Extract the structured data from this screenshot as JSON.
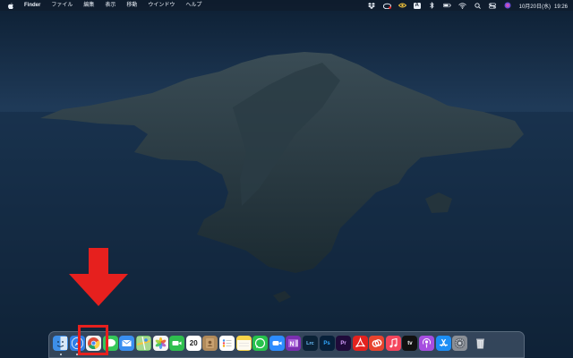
{
  "menubar": {
    "app_name": "Finder",
    "menus": [
      "ファイル",
      "編集",
      "表示",
      "移動",
      "ウインドウ",
      "ヘルプ"
    ],
    "status_icons": [
      "dropbox-icon",
      "creative-cloud-icon",
      "eye-icon",
      "text-input-icon",
      "bluetooth-icon",
      "battery-icon",
      "wifi-icon",
      "search-icon",
      "control-center-icon",
      "siri-icon"
    ],
    "input_source": "A",
    "date": "10月20日(水)",
    "time": "19:26"
  },
  "dock": {
    "apps": [
      {
        "name": "Finder",
        "icon": "finder-icon",
        "color": "#3d8fe8",
        "glyph": "",
        "running": true
      },
      {
        "name": "Safari",
        "icon": "safari-icon",
        "color": "#2f7ee6",
        "glyph": "",
        "running": true
      },
      {
        "name": "Chrome",
        "icon": "chrome-icon",
        "color": "#f1f1f1",
        "glyph": "",
        "running": false
      },
      {
        "name": "Messages",
        "icon": "messages-icon",
        "color": "#35c759",
        "glyph": "",
        "running": false
      },
      {
        "name": "Mail",
        "icon": "mail-icon",
        "color": "#3a8ff0",
        "glyph": "",
        "running": false
      },
      {
        "name": "Maps",
        "icon": "maps-icon",
        "color": "#6fc46a",
        "glyph": "",
        "running": false
      },
      {
        "name": "Photos",
        "icon": "photos-icon",
        "color": "#f5f5f5",
        "glyph": "",
        "running": false
      },
      {
        "name": "FaceTime",
        "icon": "facetime-icon",
        "color": "#2fbf4f",
        "glyph": "",
        "running": false
      },
      {
        "name": "Calendar",
        "icon": "calendar-icon",
        "color": "#ffffff",
        "glyph": "20",
        "running": false
      },
      {
        "name": "Contacts",
        "icon": "contacts-icon",
        "color": "#b08a5b",
        "glyph": "",
        "running": false
      },
      {
        "name": "Reminders",
        "icon": "reminders-icon",
        "color": "#ffffff",
        "glyph": "",
        "running": false
      },
      {
        "name": "Notes",
        "icon": "notes-icon",
        "color": "#f8d44a",
        "glyph": "",
        "running": false
      },
      {
        "name": "WhatsApp",
        "icon": "whatsapp-icon",
        "color": "#27c24c",
        "glyph": "",
        "running": false
      },
      {
        "name": "Zoom",
        "icon": "zoom-icon",
        "color": "#2d8cff",
        "glyph": "",
        "running": false
      },
      {
        "name": "OneNote",
        "icon": "onenote-icon",
        "color": "#7a2fb0",
        "glyph": "",
        "running": false
      },
      {
        "name": "Lightroom Classic",
        "icon": "lightroom-icon",
        "color": "#0b2236",
        "glyph": "Lrc",
        "running": false
      },
      {
        "name": "Photoshop",
        "icon": "photoshop-icon",
        "color": "#07203a",
        "glyph": "Ps",
        "running": false
      },
      {
        "name": "Premiere Pro",
        "icon": "premiere-icon",
        "color": "#1f0b3a",
        "glyph": "Pr",
        "running": false
      },
      {
        "name": "Acrobat",
        "icon": "acrobat-icon",
        "color": "#e3231f",
        "glyph": "",
        "running": false
      },
      {
        "name": "Creative Cloud",
        "icon": "creative-cloud-app-icon",
        "color": "#e8442e",
        "glyph": "",
        "running": false
      },
      {
        "name": "Music",
        "icon": "music-icon",
        "color": "#f5455c",
        "glyph": "",
        "running": false
      },
      {
        "name": "TV",
        "icon": "tv-icon",
        "color": "#111111",
        "glyph": "tv",
        "running": false
      },
      {
        "name": "Podcasts",
        "icon": "podcasts-icon",
        "color": "#a64ee0",
        "glyph": "",
        "running": false
      },
      {
        "name": "App Store",
        "icon": "app-store-icon",
        "color": "#1c8ef5",
        "glyph": "",
        "running": false
      },
      {
        "name": "System Preferences",
        "icon": "system-preferences-icon",
        "color": "#8a8f96",
        "glyph": "",
        "running": false
      },
      {
        "name": "Trash",
        "icon": "trash-icon",
        "color": "#c8ccd2",
        "glyph": "",
        "running": false
      }
    ]
  },
  "annotation": {
    "arrow_color": "#e6201e",
    "target_app": "Safari"
  }
}
